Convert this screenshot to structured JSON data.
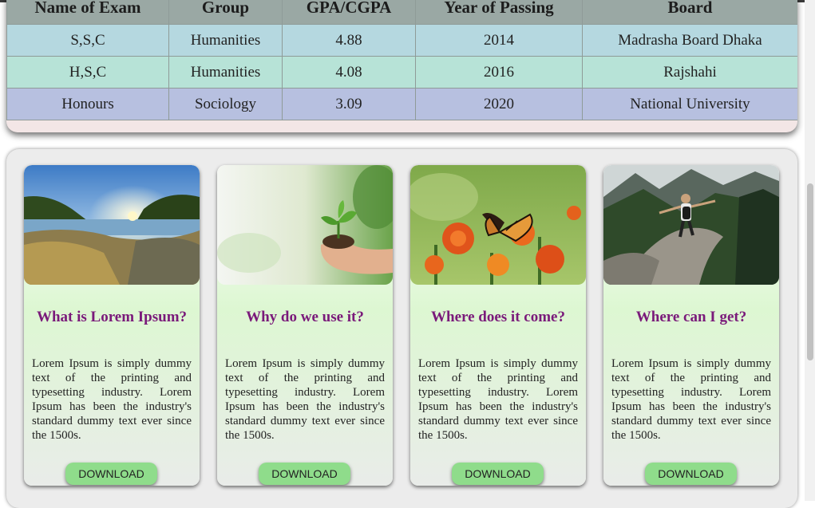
{
  "education": {
    "headers": [
      "Name of Exam",
      "Group",
      "GPA/CGPA",
      "Year of Passing",
      "Board"
    ],
    "rows": [
      [
        "S,S,C",
        "Humanities",
        "4.88",
        "2014",
        "Madrasha Board Dhaka"
      ],
      [
        "H,S,C",
        "Humanities",
        "4.08",
        "2016",
        "Rajshahi"
      ],
      [
        "Honours",
        "Sociology",
        "3.09",
        "2020",
        "National University"
      ]
    ]
  },
  "cards": [
    {
      "title": "What is Lorem Ipsum?",
      "text": "Lorem Ipsum is simply dummy text of the printing and typesetting industry. Lorem Ipsum has been the industry's standard dummy text ever since the 1500s.",
      "button": "DOWNLOAD",
      "image": "sunset-lake-landscape"
    },
    {
      "title": "Why do we use it?",
      "text": "Lorem Ipsum is simply dummy text of the printing and typesetting industry. Lorem Ipsum has been the industry's standard dummy text ever since the 1500s.",
      "button": "DOWNLOAD",
      "image": "hand-holding-seedling"
    },
    {
      "title": "Where does it come?",
      "text": "Lorem Ipsum is simply dummy text of the printing and typesetting industry. Lorem Ipsum has been the industry's standard dummy text ever since the 1500s.",
      "button": "DOWNLOAD",
      "image": "butterfly-on-flowers"
    },
    {
      "title": "Where can I get?",
      "text": "Lorem Ipsum is simply dummy text of the printing and typesetting industry. Lorem Ipsum has been the industry's standard dummy text ever since the 1500s.",
      "button": "DOWNLOAD",
      "image": "hiker-on-mountain-trail"
    }
  ],
  "colors": {
    "header_bg": "#9aa8a4",
    "row1_bg": "#b5d8e0",
    "row2_bg": "#b7e3d7",
    "row3_bg": "#b7c0e0",
    "card_title": "#7a1a7a",
    "button_bg": "#8fdc8b"
  }
}
